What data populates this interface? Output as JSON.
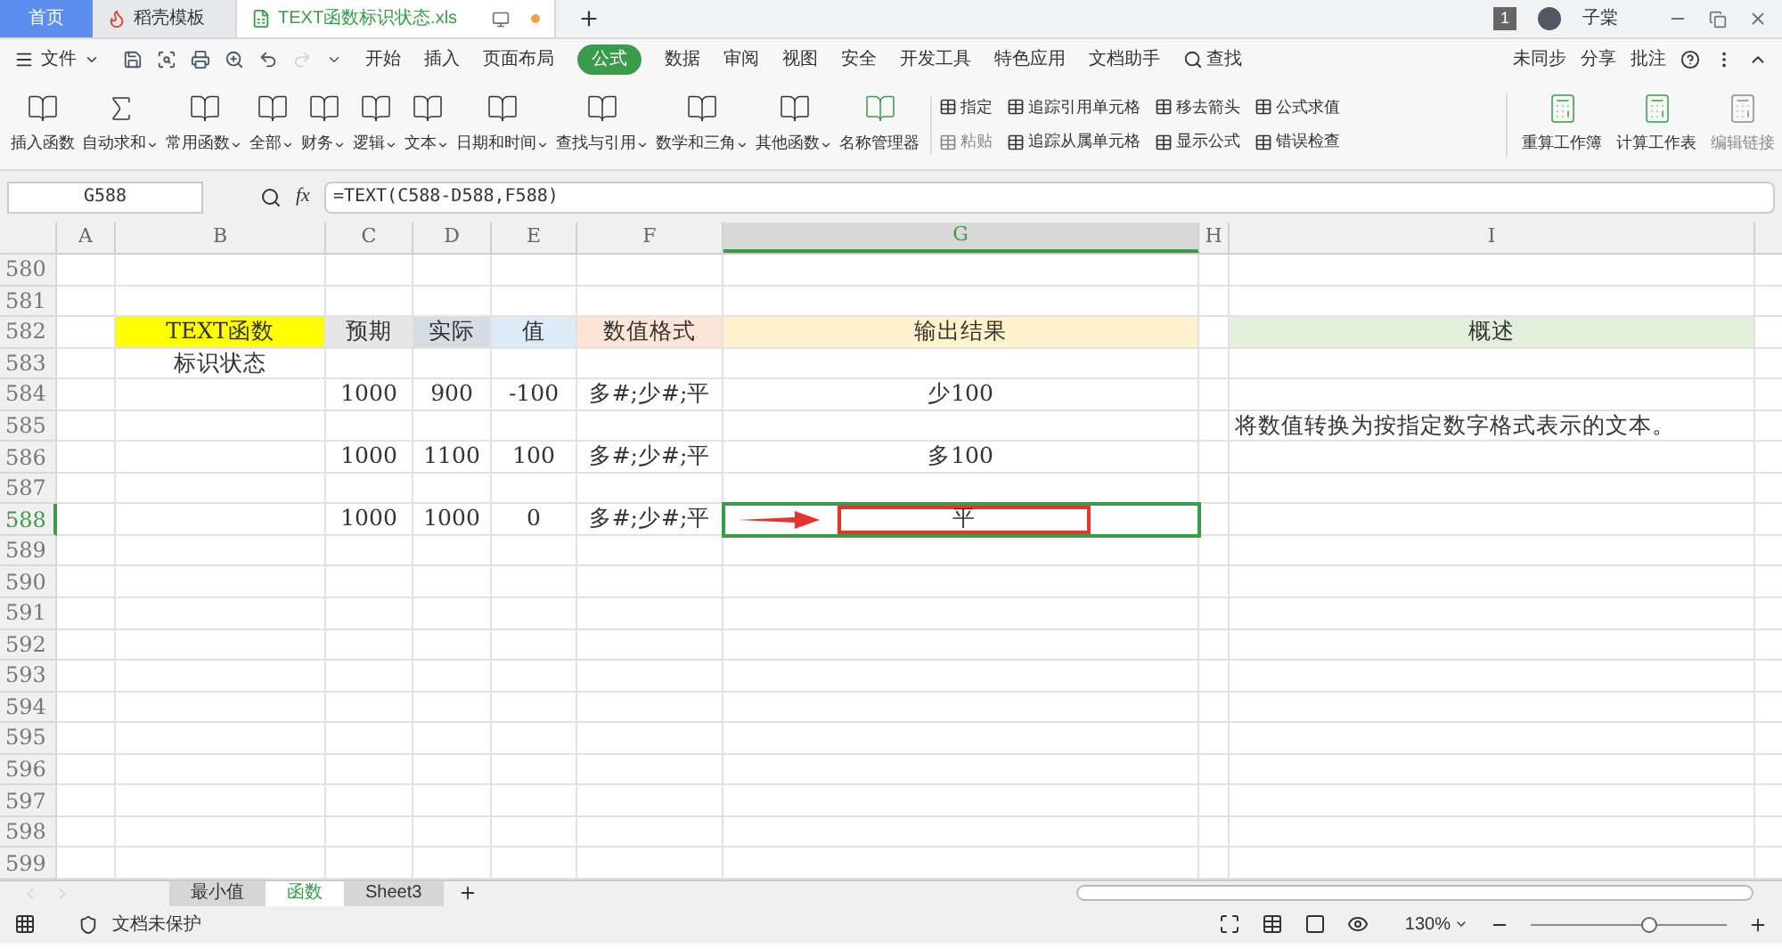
{
  "tabs": [
    {
      "label": "首页",
      "kind": "home",
      "selected": false
    },
    {
      "label": "稻壳模板",
      "kind": "docer",
      "selected": false
    },
    {
      "label": "TEXT函数标识状态.xls",
      "kind": "file",
      "selected": true
    }
  ],
  "window": {
    "badge": "1",
    "user": "子棠"
  },
  "menu": {
    "file": "文件",
    "items": [
      {
        "label": "开始",
        "selected": false
      },
      {
        "label": "插入",
        "selected": false
      },
      {
        "label": "页面布局",
        "selected": false
      },
      {
        "label": "公式",
        "selected": true
      },
      {
        "label": "数据",
        "selected": false
      },
      {
        "label": "审阅",
        "selected": false
      },
      {
        "label": "视图",
        "selected": false
      },
      {
        "label": "安全",
        "selected": false
      },
      {
        "label": "开发工具",
        "selected": false
      },
      {
        "label": "特色应用",
        "selected": false
      },
      {
        "label": "文档助手",
        "selected": false
      }
    ],
    "search": "查找",
    "right": [
      "未同步",
      "分享",
      "批注"
    ]
  },
  "ribbon": {
    "big": [
      {
        "label": "插入函数",
        "dropdown": false
      },
      {
        "label": "自动求和",
        "dropdown": true
      },
      {
        "label": "常用函数",
        "dropdown": true
      },
      {
        "label": "全部",
        "dropdown": true
      },
      {
        "label": "财务",
        "dropdown": true
      },
      {
        "label": "逻辑",
        "dropdown": true
      },
      {
        "label": "文本",
        "dropdown": true
      },
      {
        "label": "日期和时间",
        "dropdown": true
      },
      {
        "label": "查找与引用",
        "dropdown": true
      },
      {
        "label": "数学和三角",
        "dropdown": true
      },
      {
        "label": "其他函数",
        "dropdown": true
      },
      {
        "label": "名称管理器",
        "dropdown": false
      }
    ],
    "small": [
      {
        "label": "指定",
        "disabled": false
      },
      {
        "label": "粘贴",
        "disabled": true
      },
      {
        "label": "追踪引用单元格",
        "disabled": false
      },
      {
        "label": "追踪从属单元格",
        "disabled": false
      },
      {
        "label": "移去箭头",
        "disabled": false
      },
      {
        "label": "显示公式",
        "disabled": false
      },
      {
        "label": "公式求值",
        "disabled": false
      },
      {
        "label": "错误检查",
        "disabled": false
      }
    ],
    "end": [
      {
        "label": "重算工作簿",
        "disabled": false
      },
      {
        "label": "计算工作表",
        "disabled": false
      },
      {
        "label": "编辑链接",
        "disabled": true
      }
    ]
  },
  "formula_bar": {
    "name_box": "G588",
    "fx": "fx",
    "formula": "=TEXT(C588-D588,F588)"
  },
  "columns": [
    {
      "label": "A",
      "selected": false
    },
    {
      "label": "B",
      "selected": false
    },
    {
      "label": "C",
      "selected": false
    },
    {
      "label": "D",
      "selected": false
    },
    {
      "label": "E",
      "selected": false
    },
    {
      "label": "F",
      "selected": false
    },
    {
      "label": "G",
      "selected": true
    },
    {
      "label": "H",
      "selected": false
    },
    {
      "label": "I",
      "selected": false
    }
  ],
  "rows": [
    {
      "number": "580",
      "selected": false,
      "cells": {}
    },
    {
      "number": "581",
      "selected": false,
      "cells": {}
    },
    {
      "number": "582",
      "selected": false,
      "cells": {
        "b": {
          "text": "TEXT函数",
          "color": "#ffff00"
        },
        "c": {
          "text": "预期",
          "color": "#e7e6e6"
        },
        "d": {
          "text": "实际",
          "color": "#d6dce4"
        },
        "e": {
          "text": "值",
          "color": "#ddebf7"
        },
        "f": {
          "text": "数值格式",
          "color": "#fce4d6"
        },
        "g": {
          "text": "输出结果",
          "color": "#fff2cc"
        },
        "i": {
          "text": "概述",
          "color": "#e2efda"
        }
      }
    },
    {
      "number": "583",
      "selected": false,
      "cells": {
        "b": {
          "text": "标识状态"
        }
      }
    },
    {
      "number": "584",
      "selected": false,
      "cells": {
        "c": {
          "text": "1000"
        },
        "d": {
          "text": "900"
        },
        "e": {
          "text": "-100"
        },
        "f": {
          "text": "多#;少#;平"
        },
        "g": {
          "text": "少100"
        }
      }
    },
    {
      "number": "585",
      "selected": false,
      "cells": {
        "i": {
          "text": "将数值转换为按指定数字格式表示的文本。",
          "overflow": true
        }
      }
    },
    {
      "number": "586",
      "selected": false,
      "cells": {
        "c": {
          "text": "1000"
        },
        "d": {
          "text": "1100"
        },
        "e": {
          "text": "100"
        },
        "f": {
          "text": "多#;少#;平"
        },
        "g": {
          "text": "多100"
        }
      }
    },
    {
      "number": "587",
      "selected": false,
      "cells": {}
    },
    {
      "number": "588",
      "selected": true,
      "cells": {
        "c": {
          "text": "1000"
        },
        "d": {
          "text": "1000"
        },
        "e": {
          "text": "0"
        },
        "f": {
          "text": "多#;少#;平"
        },
        "g": {
          "text": "平",
          "active": true,
          "highlighted": true
        }
      }
    },
    {
      "number": "589",
      "selected": false,
      "cells": {}
    },
    {
      "number": "590",
      "selected": false,
      "cells": {}
    },
    {
      "number": "591",
      "selected": false,
      "cells": {}
    },
    {
      "number": "592",
      "selected": false,
      "cells": {}
    },
    {
      "number": "593",
      "selected": false,
      "cells": {}
    },
    {
      "number": "594",
      "selected": false,
      "cells": {}
    },
    {
      "number": "595",
      "selected": false,
      "cells": {}
    },
    {
      "number": "596",
      "selected": false,
      "cells": {}
    },
    {
      "number": "597",
      "selected": false,
      "cells": {}
    },
    {
      "number": "598",
      "selected": false,
      "cells": {}
    },
    {
      "number": "599",
      "selected": false,
      "cells": {}
    }
  ],
  "sheets": [
    {
      "label": "最小值",
      "selected": false
    },
    {
      "label": "函数",
      "selected": true
    },
    {
      "label": "Sheet3",
      "selected": false
    }
  ],
  "status": {
    "protect": "文档未保护",
    "zoom": "130%",
    "level": 0.6
  }
}
